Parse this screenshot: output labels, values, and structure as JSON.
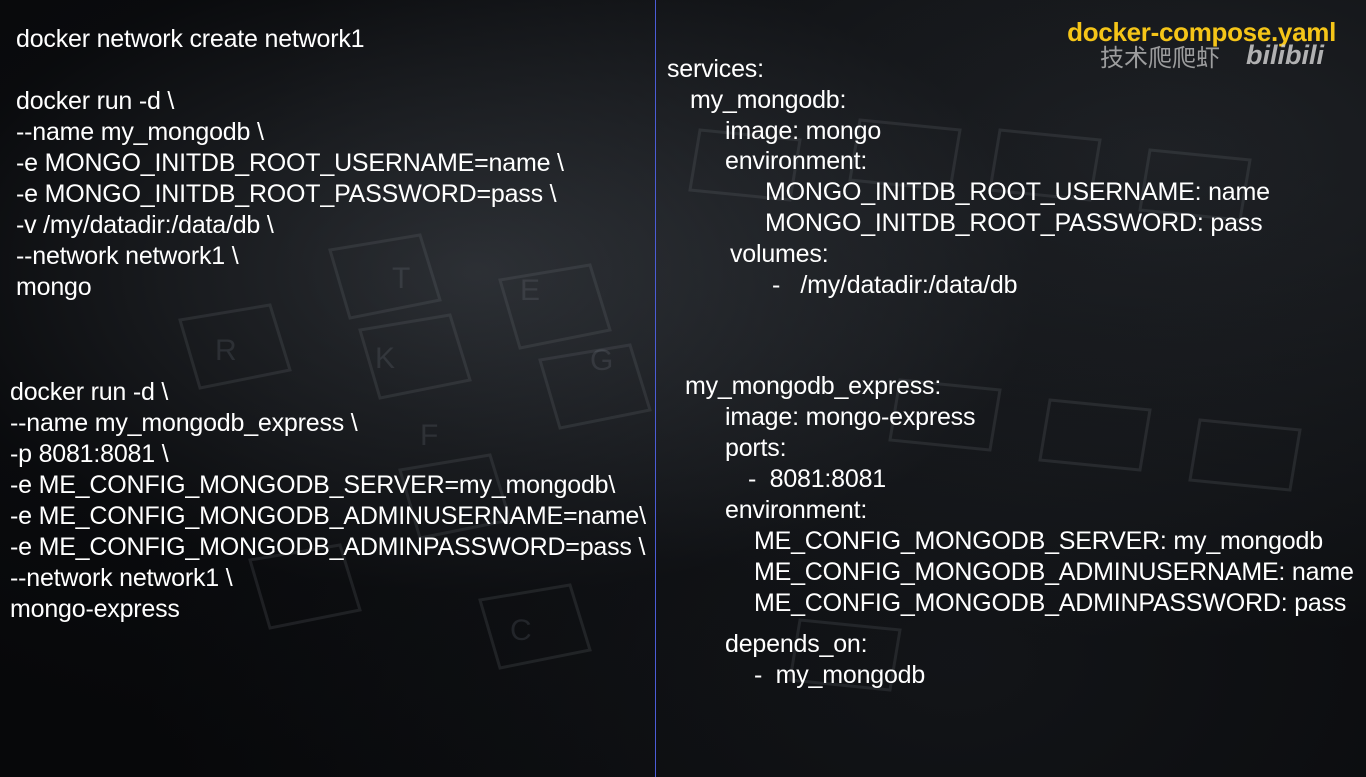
{
  "title": "docker-compose.yaml",
  "watermark": {
    "text": "技术爬爬虾",
    "logo": "bilibili"
  },
  "left_panel": {
    "block1": [
      "docker network create network1",
      "",
      "docker run -d \\",
      "--name my_mongodb \\",
      "-e MONGO_INITDB_ROOT_USERNAME=name \\",
      "-e MONGO_INITDB_ROOT_PASSWORD=pass \\",
      "-v /my/datadir:/data/db \\",
      "--network network1 \\",
      "mongo"
    ],
    "block2": [
      "docker run -d \\",
      "--name my_mongodb_express \\",
      "-p 8081:8081 \\",
      "-e ME_CONFIG_MONGODB_SERVER=my_mongodb\\",
      "-e ME_CONFIG_MONGODB_ADMINUSERNAME=name\\",
      "-e ME_CONFIG_MONGODB_ADMINPASSWORD=pass \\",
      "--network network1 \\",
      "mongo-express"
    ]
  },
  "right_panel": {
    "block1": [
      "services:",
      "my_mongodb:",
      "image: mongo",
      "environment:",
      "MONGO_INITDB_ROOT_USERNAME: name",
      "MONGO_INITDB_ROOT_PASSWORD: pass",
      "volumes:",
      "-   /my/datadir:/data/db"
    ],
    "block2": [
      "my_mongodb_express:",
      "image: mongo-express",
      "ports:",
      "-  8081:8081",
      "environment:",
      "ME_CONFIG_MONGODB_SERVER: my_mongodb",
      "ME_CONFIG_MONGODB_ADMINUSERNAME: name",
      "ME_CONFIG_MONGODB_ADMINPASSWORD: pass",
      "depends_on:",
      "-  my_mongodb"
    ]
  },
  "colors": {
    "title": "#f5c518",
    "text": "#ffffff",
    "divider": "#4b5cd6",
    "background": "#07080a"
  }
}
